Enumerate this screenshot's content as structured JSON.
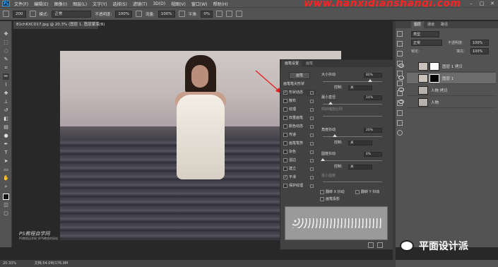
{
  "app": {
    "logo": "Ps",
    "watermark": "www.hanxidianshangi.com"
  },
  "menubar": {
    "items": [
      "文件(F)",
      "编辑(E)",
      "图像(I)",
      "图层(L)",
      "文字(Y)",
      "选择(S)",
      "滤镜(T)",
      "3D(D)",
      "视图(V)",
      "窗口(W)",
      "帮助(H)"
    ]
  },
  "optionsbar": {
    "brush_size": "200",
    "mode_label": "模式:",
    "mode_value": "正常",
    "opacity_label": "不透明度:",
    "opacity_value": "100%",
    "flow_label": "流量:",
    "flow_value": "100%",
    "smooth_label": "平滑:",
    "smooth_value": "0%"
  },
  "document": {
    "tab_title": "81chKXCD17.jpg @ 20.3% (图层 1, 图层蒙版/8)",
    "canvas_watermark_title": "PS教程自学网",
    "canvas_watermark_sub": "PS教程自学网 学PS教程的网站"
  },
  "brush_panel": {
    "tabs": [
      "画笔设置",
      "画笔"
    ],
    "preset_button": "画笔",
    "items": [
      {
        "label": "画笔笔尖形状",
        "checked": false
      },
      {
        "label": "形状动态",
        "checked": true,
        "selected": true
      },
      {
        "label": "散布",
        "checked": false
      },
      {
        "label": "纹理",
        "checked": false
      },
      {
        "label": "双重画笔",
        "checked": false
      },
      {
        "label": "颜色动态",
        "checked": false
      },
      {
        "label": "传递",
        "checked": false
      },
      {
        "label": "画笔笔势",
        "checked": false
      },
      {
        "label": "杂色",
        "checked": false
      },
      {
        "label": "湿边",
        "checked": false
      },
      {
        "label": "建立",
        "checked": false
      },
      {
        "label": "平滑",
        "checked": true
      },
      {
        "label": "保护纹理",
        "checked": false
      }
    ],
    "size_jitter": {
      "label": "大小抖动",
      "value": "80%"
    },
    "control1": {
      "label": "控制:",
      "value": "关"
    },
    "min_diameter": {
      "label": "最小直径",
      "value": "14%"
    },
    "tilt_scale": {
      "label": "倾斜缩放比例"
    },
    "angle_jitter": {
      "label": "角度抖动",
      "value": "20%"
    },
    "control2": {
      "label": "控制:",
      "value": "关"
    },
    "roundness_jitter": {
      "label": "圆度抖动",
      "value": "0%"
    },
    "control3": {
      "label": "控制:",
      "value": "关"
    },
    "min_roundness": {
      "label": "最小圆度"
    },
    "flip_x": "翻转 X 抖动",
    "flip_y": "翻转 Y 抖动",
    "brush_projection": "画笔投影"
  },
  "layers_panel": {
    "tabs": [
      "图层",
      "通道",
      "路径"
    ],
    "filter_label": "类型",
    "blend_mode": "正常",
    "opacity_label": "不透明度:",
    "opacity_value": "100%",
    "lock_label": "锁定:",
    "fill_label": "填充:",
    "fill_value": "100%",
    "layers": [
      {
        "name": "图层 1 拷贝",
        "active": false
      },
      {
        "name": "图层 1",
        "active": true
      },
      {
        "name": "人物 拷贝",
        "active": false
      },
      {
        "name": "人物",
        "active": false
      }
    ]
  },
  "status": {
    "zoom": "20.33%",
    "doc": "文档:54.0M/176.9M"
  },
  "footer_brand": {
    "text": "平面设计派"
  },
  "colors": {
    "accent": "#31a8ff",
    "arrow": "#e02020",
    "panel": "#424242",
    "chrome": "#535353"
  }
}
